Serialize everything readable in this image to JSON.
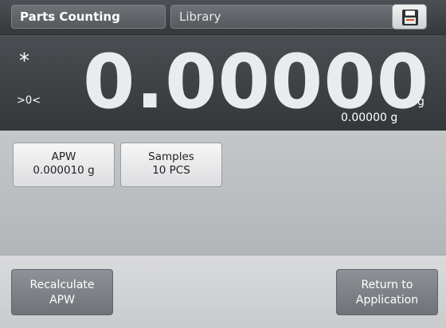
{
  "header": {
    "app_label": "Parts Counting",
    "library_label": "Library",
    "save_icon": "floppy-disk-icon"
  },
  "display": {
    "stable_indicator": "*",
    "center_of_zero": ">0<",
    "weight": "0.00000",
    "unit": "g",
    "secondary_weight": "0.00000 g"
  },
  "tiles": {
    "apw": {
      "title": "APW",
      "value": "0.000010 g"
    },
    "samples": {
      "title": "Samples",
      "value": "10 PCS"
    }
  },
  "footer": {
    "recalculate": {
      "line1": "Recalculate",
      "line2": "APW"
    },
    "return_to_app": {
      "line1": "Return to",
      "line2": "Application"
    }
  },
  "colors": {
    "header_bg": "#404346",
    "display_bg": "#3f4246",
    "middle_bg": "#bcbfc1",
    "bottom_bg": "#d2d3d5",
    "button_bg": "#7f8388"
  }
}
